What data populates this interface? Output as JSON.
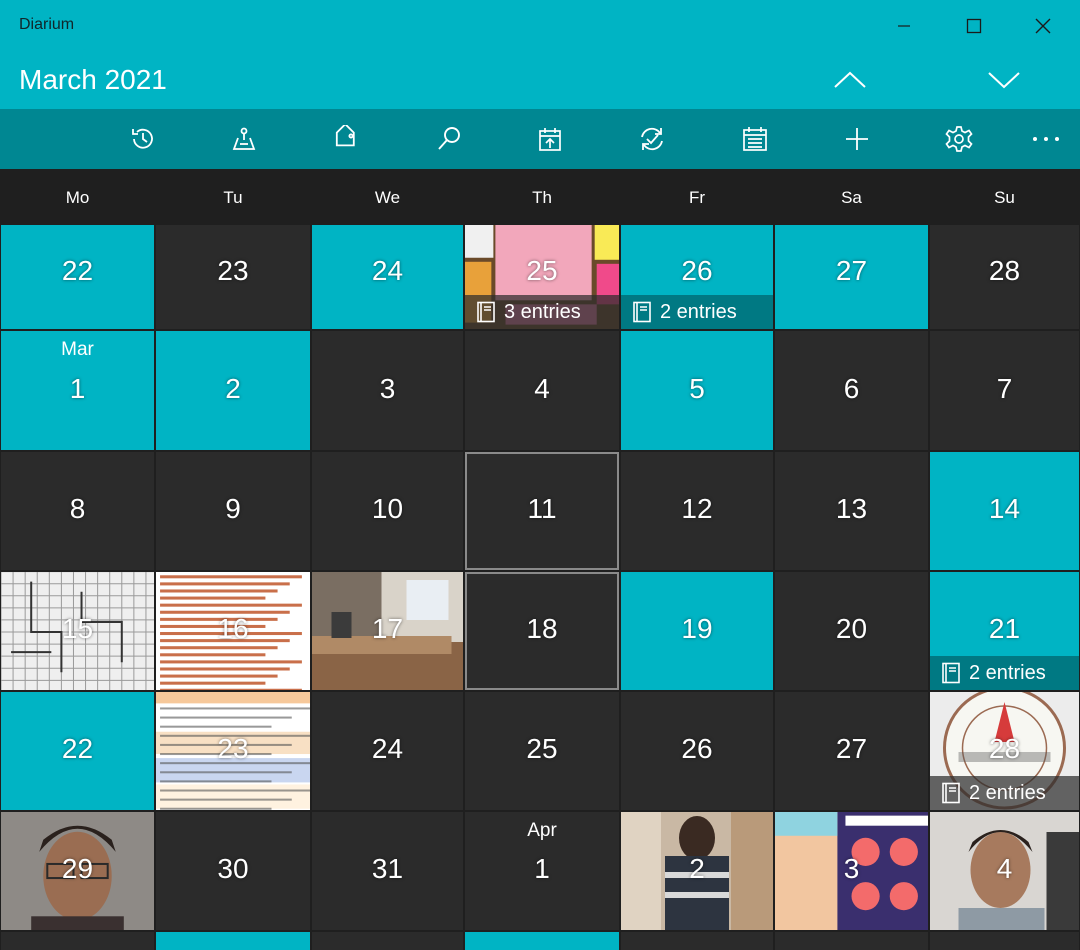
{
  "app": {
    "title": "Diarium"
  },
  "header": {
    "month_title": "March 2021"
  },
  "colors": {
    "accent": "#00b4c4",
    "toolbar": "#008792",
    "cell": "#2b2b2b",
    "background": "#1f1f1f"
  },
  "toolbar": {
    "items": [
      {
        "name": "history-icon"
      },
      {
        "name": "map-icon"
      },
      {
        "name": "tag-icon"
      },
      {
        "name": "search-icon"
      },
      {
        "name": "calendar-export-icon"
      },
      {
        "name": "sync-icon"
      },
      {
        "name": "calendar-icon"
      },
      {
        "name": "add-icon"
      },
      {
        "name": "settings-icon"
      },
      {
        "name": "more-icon"
      }
    ]
  },
  "weekdays": [
    "Mo",
    "Tu",
    "We",
    "Th",
    "Fr",
    "Sa",
    "Su"
  ],
  "weeks": [
    [
      {
        "day": "22",
        "style": "accent"
      },
      {
        "day": "23"
      },
      {
        "day": "24",
        "style": "accent"
      },
      {
        "day": "25",
        "photo": "sticky-notes",
        "entries": "3 entries"
      },
      {
        "day": "26",
        "style": "accent",
        "entries": "2 entries"
      },
      {
        "day": "27",
        "style": "accent"
      },
      {
        "day": "28"
      }
    ],
    [
      {
        "day": "1",
        "style": "accent",
        "month": "Mar"
      },
      {
        "day": "2",
        "style": "accent"
      },
      {
        "day": "3"
      },
      {
        "day": "4"
      },
      {
        "day": "5",
        "style": "accent"
      },
      {
        "day": "6"
      },
      {
        "day": "7"
      }
    ],
    [
      {
        "day": "8"
      },
      {
        "day": "9"
      },
      {
        "day": "10"
      },
      {
        "day": "11",
        "selected": true
      },
      {
        "day": "12"
      },
      {
        "day": "13"
      },
      {
        "day": "14",
        "style": "accent"
      }
    ],
    [
      {
        "day": "15",
        "photo": "puzzle"
      },
      {
        "day": "16",
        "photo": "document"
      },
      {
        "day": "17",
        "photo": "room"
      },
      {
        "day": "18",
        "selected": true
      },
      {
        "day": "19",
        "style": "accent"
      },
      {
        "day": "20"
      },
      {
        "day": "21",
        "style": "accent",
        "entries": "2 entries"
      }
    ],
    [
      {
        "day": "22",
        "style": "accent"
      },
      {
        "day": "23",
        "photo": "worksheet"
      },
      {
        "day": "24"
      },
      {
        "day": "25"
      },
      {
        "day": "26"
      },
      {
        "day": "27"
      },
      {
        "day": "28",
        "photo": "seal",
        "entries": "2 entries"
      }
    ],
    [
      {
        "day": "29",
        "photo": "portrait"
      },
      {
        "day": "30"
      },
      {
        "day": "31"
      },
      {
        "day": "1",
        "month": "Apr"
      },
      {
        "day": "2",
        "photo": "shop"
      },
      {
        "day": "3",
        "photo": "infographic"
      },
      {
        "day": "4",
        "photo": "portrait2"
      }
    ]
  ],
  "next_week_styles": [
    "dark",
    "accent",
    "dark",
    "accent",
    "dark",
    "dark",
    "dark"
  ]
}
